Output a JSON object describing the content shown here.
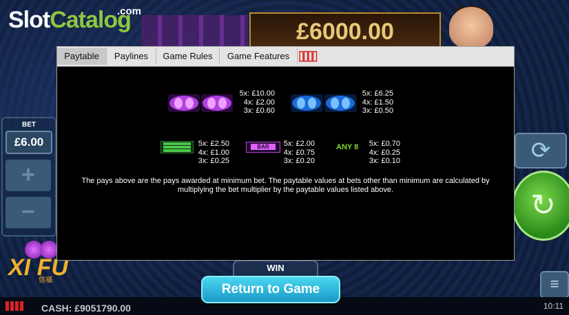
{
  "brand": {
    "logo_white": "Slot",
    "logo_green": "Catalog",
    "logo_suffix": ".com"
  },
  "jackpot": {
    "amount": "£6000.00"
  },
  "bet": {
    "label": "BET",
    "value": "£6.00",
    "plus_label": "+",
    "minus_label": "−"
  },
  "game_logo": {
    "title": "XI FU",
    "subtitle": "信福"
  },
  "win": {
    "label": "WIN"
  },
  "dialog": {
    "tabs": [
      {
        "label": "Paytable",
        "active": true
      },
      {
        "label": "Paylines",
        "active": false
      },
      {
        "label": "Game Rules",
        "active": false
      },
      {
        "label": "Game Features",
        "active": false
      }
    ],
    "paytable": {
      "purple_8": {
        "5x": "5x: £10.00",
        "4x": "4x: £2.00",
        "3x": "3x: £0.60"
      },
      "blue_8": {
        "5x": "5x: £6.25",
        "4x": "4x: £1.50",
        "3x": "3x: £0.50"
      },
      "triple_bar": {
        "symbol_text": "BAR",
        "5x": "5x: £2.50",
        "4x": "4x: £1.00",
        "3x": "3x: £0.25"
      },
      "single_bar": {
        "symbol_text": "BAR",
        "5x": "5x: £2.00",
        "4x": "4x: £0.75",
        "3x": "3x: £0.20"
      },
      "any_8": {
        "label": "ANY 8",
        "5x": "5x: £0.70",
        "4x": "4x: £0.25",
        "3x": "3x: £0.10"
      }
    },
    "note": "The pays above are the pays awarded at minimum bet. The paytable values at bets other than minimum are calculated by multiplying the bet multiplier by the paytable values listed above."
  },
  "return_button": {
    "label": "Return to Game"
  },
  "status_bar": {
    "cash": "CASH: £9051790.00",
    "time": "10:11"
  },
  "colors": {
    "accent_green": "#8dc63f",
    "any8_green": "#7adc2a",
    "return_button": "#1a98c8"
  }
}
